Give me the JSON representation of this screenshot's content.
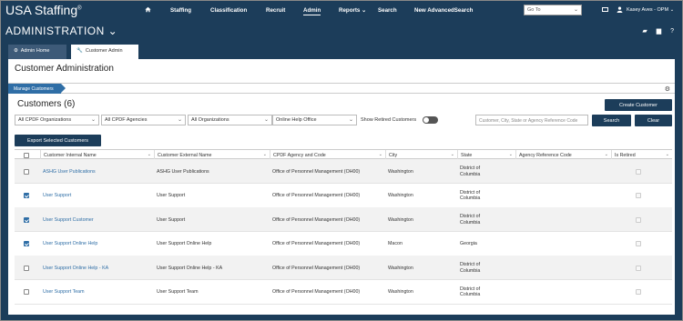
{
  "topnav": {
    "logo": "USA Staffing",
    "logo_mark": "®",
    "items": [
      "Staffing",
      "Classification",
      "Recruit",
      "Admin",
      "Reports",
      "Search",
      "New AdvancedSearch"
    ],
    "reports_chevron": "⌄",
    "goto_placeholder": "Go To",
    "user_name": "Kasey Aves - OPM",
    "user_chevron": "⌄"
  },
  "adminbar": {
    "title": "ADMINISTRATION",
    "title_chevron": "⌄"
  },
  "tabs": [
    {
      "label": "Admin Home",
      "icon": "gear-icon"
    },
    {
      "label": "Customer Admin",
      "icon": "wrench-icon"
    }
  ],
  "page": {
    "title": "Customer Administration",
    "breadcrumb": "Manage Customers",
    "customers_heading": "Customers (6)",
    "create_button": "Create Customer",
    "export_button": "Export Selected Customers",
    "search_button": "Search",
    "clear_button": "Clear",
    "search_placeholder": "Customer, City, State or Agency Reference Code",
    "show_retired_label": "Show Retired Customers"
  },
  "filters": [
    "All CPDF Organizations",
    "All CPDF Agencies",
    "All Organizations",
    "Online Help Office"
  ],
  "table": {
    "columns": [
      "Customer Internal Name",
      "Customer External Name",
      "CPDF Agency and Code",
      "City",
      "State",
      "Agency Reference Code",
      "Is Retired"
    ],
    "rows": [
      {
        "checked": false,
        "internal": "ASHG User Publications",
        "external": "ASHG User Publications",
        "agency": "Office of Personnel Management (OH00)",
        "city": "Washington",
        "state": "District of Columbia",
        "ref": ""
      },
      {
        "checked": true,
        "internal": "User Support",
        "external": "User Support",
        "agency": "Office of Personnel Management (OH00)",
        "city": "Washington",
        "state": "District of Columbia",
        "ref": ""
      },
      {
        "checked": true,
        "internal": "User Support Customer",
        "external": "User Support",
        "agency": "Office of Personnel Management (OH00)",
        "city": "Washington",
        "state": "District of Columbia",
        "ref": ""
      },
      {
        "checked": true,
        "internal": "User Support Online Help",
        "external": "User Support Online Help",
        "agency": "Office of Personnel Management (OH00)",
        "city": "Macon",
        "state": "Georgia",
        "ref": ""
      },
      {
        "checked": false,
        "internal": "User Support Online Help - KA",
        "external": "User Support Online Help - KA",
        "agency": "Office of Personnel Management (OH00)",
        "city": "Washington",
        "state": "District of Columbia",
        "ref": ""
      },
      {
        "checked": false,
        "internal": "User Support Team",
        "external": "User Support Team",
        "agency": "Office of Personnel Management (OH00)",
        "city": "Washington",
        "state": "District of Columbia",
        "ref": ""
      }
    ]
  },
  "colors": {
    "navy": "#1c3d5a",
    "link": "#2f6ea6"
  }
}
